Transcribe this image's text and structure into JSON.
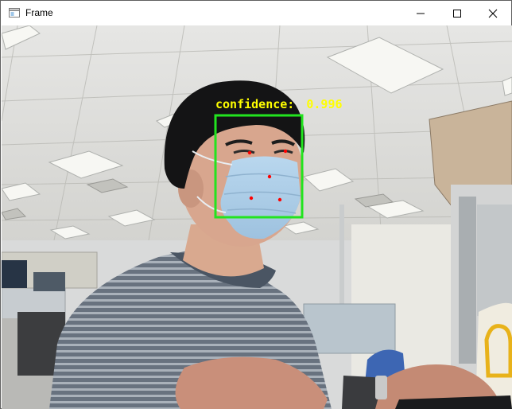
{
  "window": {
    "title": "Frame",
    "icons": {
      "app": "window-app-icon",
      "minimize": "minimize-icon",
      "maximize": "maximize-icon",
      "close": "close-icon"
    }
  },
  "detection": {
    "label": "confidence:",
    "score": "0.996",
    "box_color": "#22e41f",
    "text_color": "#ffff00",
    "landmark_color": "#ff0000"
  }
}
